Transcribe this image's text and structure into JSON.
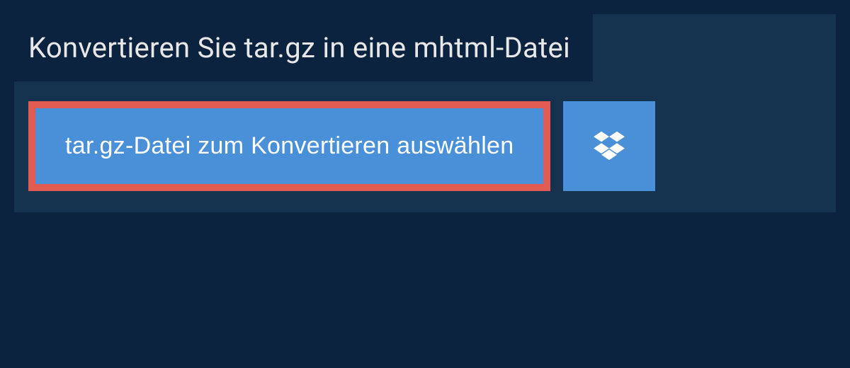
{
  "header": {
    "title": "Konvertieren Sie tar.gz in eine mhtml-Datei"
  },
  "actions": {
    "select_file_label": "tar.gz-Datei zum Konvertieren auswählen"
  },
  "colors": {
    "background": "#0c2340",
    "panel": "#15334f",
    "accent": "#4a90d9",
    "highlight_border": "#e15b52",
    "text_light": "#e8e8e8",
    "text_white": "#ffffff"
  }
}
